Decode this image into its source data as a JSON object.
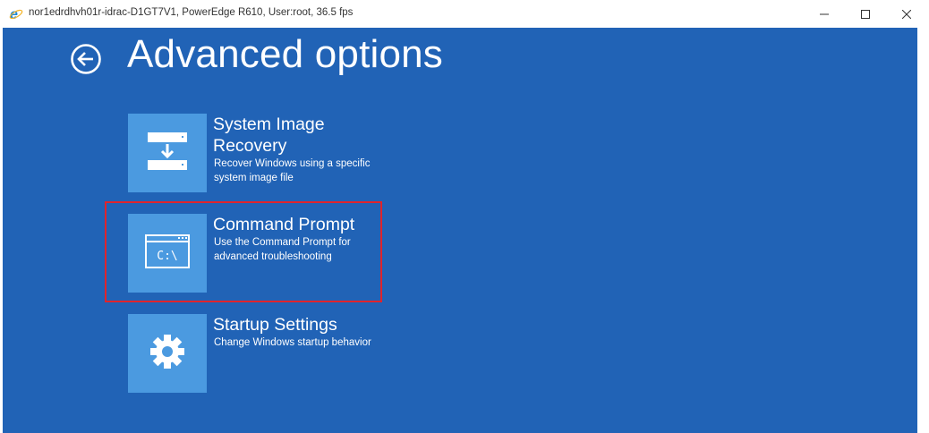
{
  "window": {
    "title": "nor1edrdhvh01r-idrac-D1GT7V1, PowerEdge R610, User:root, 36.5 fps",
    "icon": "internet-explorer-icon",
    "controls": [
      "minimize-icon",
      "maximize-icon",
      "close-icon"
    ]
  },
  "page": {
    "title": "Advanced options",
    "back_icon": "back-arrow-icon"
  },
  "options": [
    {
      "name": "System Image Recovery",
      "description": "Recover Windows using a specific system image file",
      "icon": "system-image-recovery-icon"
    },
    {
      "name": "Command Prompt",
      "description": "Use the Command Prompt for advanced troubleshooting",
      "icon": "command-prompt-icon",
      "icon_text": "C:\\",
      "highlighted": true
    },
    {
      "name": "Startup Settings",
      "description": "Change Windows startup behavior",
      "icon": "gear-icon"
    }
  ],
  "colors": {
    "background": "#2163b6",
    "tile": "#4b9ae0",
    "highlight": "#e0242c"
  }
}
